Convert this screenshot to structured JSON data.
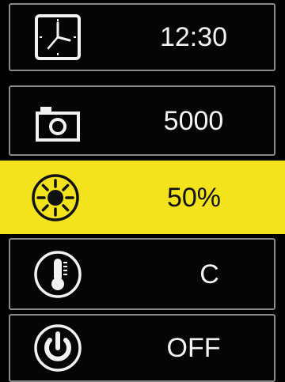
{
  "theme": {
    "background": "#000000",
    "row_border": "#8a8a8a",
    "selected_background": "#f3e31d",
    "text": "#f2f2f2"
  },
  "menu": {
    "items": [
      {
        "icon": "clock-icon",
        "value": "12:30",
        "selected": false
      },
      {
        "icon": "camera-icon",
        "value": "5000",
        "selected": false
      },
      {
        "icon": "brightness-icon",
        "value": "50%",
        "selected": true
      },
      {
        "icon": "thermometer-icon",
        "value": "C",
        "selected": false
      },
      {
        "icon": "power-icon",
        "value": "OFF",
        "selected": false
      }
    ]
  }
}
